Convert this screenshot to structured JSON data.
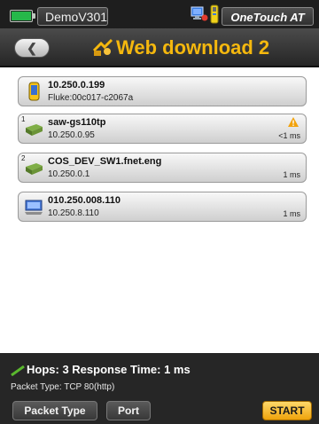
{
  "status_bar": {
    "profile_name": "DemoV301",
    "device_name": "OneTouch AT",
    "battery_level": 1.0,
    "icons": [
      "battery-icon",
      "network-status-icon",
      "usb-icon"
    ]
  },
  "header": {
    "back_icon": "back-arrow-icon",
    "title_icon": "web-download-icon",
    "title": "Web download 2"
  },
  "path": {
    "hops": [
      {
        "number": "",
        "icon": "handheld-device-icon",
        "name": "10.250.0.199",
        "detail": "Fluke:00c017-c2067a",
        "time": "",
        "warning": false
      },
      {
        "number": "1",
        "icon": "switch-icon",
        "name": "saw-gs110tp",
        "detail": "10.250.0.95",
        "time": "<1 ms",
        "warning": true
      },
      {
        "number": "2",
        "icon": "switch-icon",
        "name": "COS_DEV_SW1.fnet.eng",
        "detail": "10.250.0.1",
        "time": "1 ms",
        "warning": false
      },
      {
        "number": "",
        "icon": "computer-icon",
        "name": "010.250.008.110",
        "detail": "10.250.8.110",
        "time": "1 ms",
        "warning": false
      }
    ]
  },
  "footer": {
    "summary": "Hops:  3   Response Time:  1 ms",
    "packet_type": "Packet Type: TCP 80(http)",
    "buttons": {
      "packet_type": "Packet Type",
      "port": "Port",
      "start": "START"
    }
  },
  "colors": {
    "title_accent": "#f5b80e",
    "start_button": "#f0a81a",
    "battery": "#26b84a",
    "warning": "#f2a20c"
  }
}
